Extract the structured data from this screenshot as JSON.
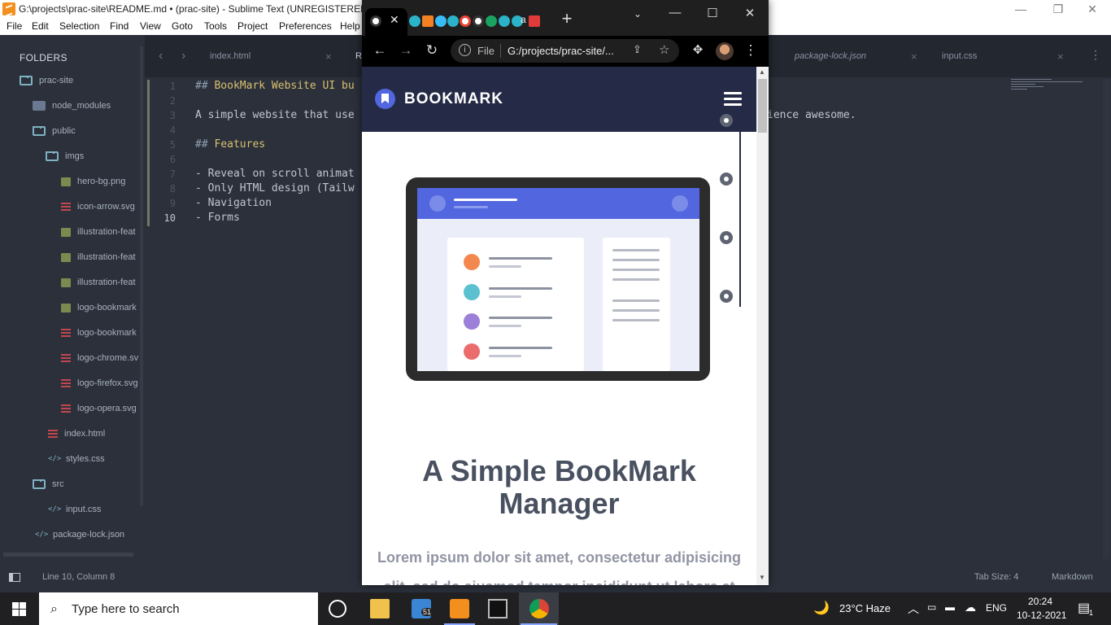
{
  "sublime": {
    "window_title": "G:\\projects\\prac-site\\README.md • (prac-site) - Sublime Text (UNREGISTERED)",
    "menu": [
      "File",
      "Edit",
      "Selection",
      "Find",
      "View",
      "Goto",
      "Tools",
      "Project",
      "Preferences",
      "Help"
    ],
    "sidebar": {
      "title": "FOLDERS",
      "tree": [
        {
          "label": "prac-site",
          "icon": "folder-open-icon"
        },
        {
          "label": "node_modules",
          "icon": "folder-icon"
        },
        {
          "label": "public",
          "icon": "folder-open-icon"
        },
        {
          "label": "imgs",
          "icon": "folder-open-icon"
        },
        {
          "label": "hero-bg.png",
          "icon": "image-file-icon"
        },
        {
          "label": "icon-arrow.svg",
          "icon": "svg-file-icon"
        },
        {
          "label": "illustration-feat",
          "icon": "image-file-icon"
        },
        {
          "label": "illustration-feat",
          "icon": "image-file-icon"
        },
        {
          "label": "illustration-feat",
          "icon": "image-file-icon"
        },
        {
          "label": "logo-bookmark",
          "icon": "image-file-icon"
        },
        {
          "label": "logo-bookmark",
          "icon": "svg-file-icon"
        },
        {
          "label": "logo-chrome.sv",
          "icon": "svg-file-icon"
        },
        {
          "label": "logo-firefox.svg",
          "icon": "svg-file-icon"
        },
        {
          "label": "logo-opera.svg",
          "icon": "svg-file-icon"
        },
        {
          "label": "index.html",
          "icon": "svg-file-icon"
        },
        {
          "label": "styles.css",
          "icon": "code-file-icon"
        },
        {
          "label": "src",
          "icon": "folder-open-icon"
        },
        {
          "label": "input.css",
          "icon": "code-file-icon"
        },
        {
          "label": "package-lock.json",
          "icon": "code-file-icon"
        }
      ]
    },
    "tabs": [
      {
        "label": "index.html"
      },
      {
        "label": "R"
      },
      {
        "label": "package-lock.json"
      },
      {
        "label": "input.css"
      }
    ],
    "editor": {
      "line_numbers": [
        "1",
        "2",
        "3",
        "4",
        "5",
        "6",
        "7",
        "8",
        "9",
        "10"
      ],
      "lines": [
        {
          "hash": "##",
          "text": " BookMark Website UI bu"
        },
        {
          "hash": "",
          "text": ""
        },
        {
          "hash": "",
          "text": "A simple website that use"
        },
        {
          "hash": "",
          "text": ""
        },
        {
          "hash": "##",
          "text": " Features"
        },
        {
          "hash": "",
          "text": ""
        },
        {
          "hash": "",
          "text": "- Reveal on scroll animat"
        },
        {
          "hash": "",
          "text": "- Only HTML design (Tailw"
        },
        {
          "hash": "",
          "text": "- Navigation"
        },
        {
          "hash": "",
          "text": "- Forms"
        }
      ],
      "line3_tail": "ience awesome."
    },
    "status": {
      "position": "Line 10, Column 8",
      "tab_size": "Tab Size: 4",
      "syntax": "Markdown"
    }
  },
  "chrome": {
    "address": {
      "scheme_label": "File",
      "url": "G:/projects/prac-site/..."
    },
    "page": {
      "brand": "BOOKMARK",
      "hero_title": "A Simple BookMark Manager",
      "hero_text": "Lorem ipsum dolor sit amet, consectetur adipisicing elit, sed do eiusmod tempor incididunt ut labore et"
    }
  },
  "taskbar": {
    "search_placeholder": "Type here to search",
    "explorer_badge": "51",
    "weather": "23°C  Haze",
    "language": "ENG",
    "time": "20:24",
    "date": "10-12-2021",
    "notifications": "1"
  },
  "colors": {
    "editor_bg": "#2b303b",
    "site_header": "#252b46",
    "brand_blue": "#5267df",
    "taskbar": "#202023"
  }
}
